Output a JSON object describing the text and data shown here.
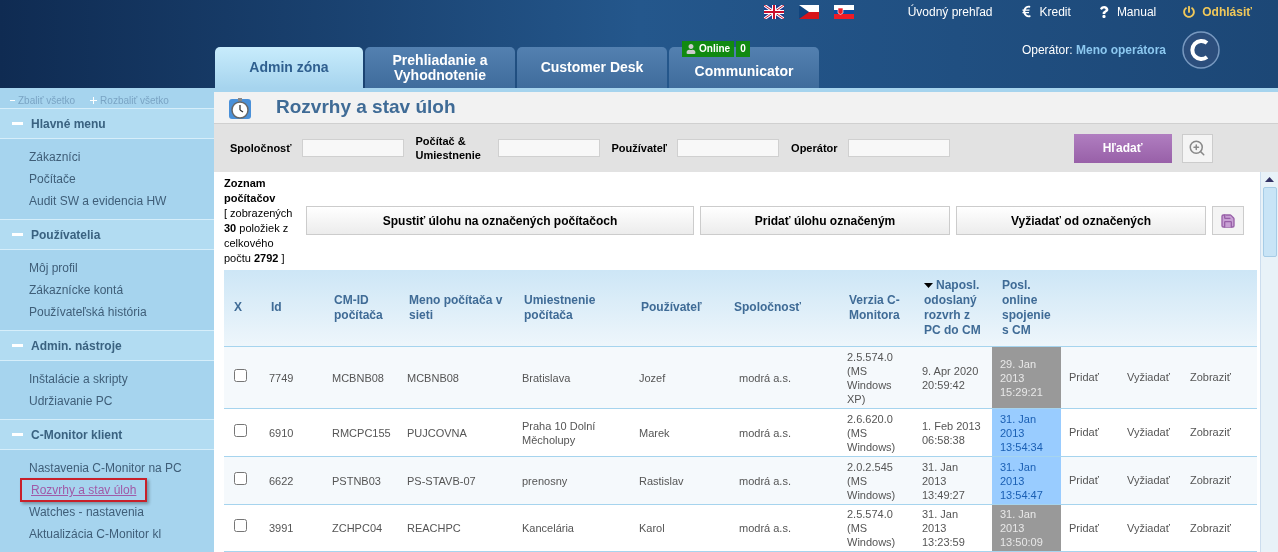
{
  "top_links": [
    {
      "label": "Úvodný prehľad",
      "kind": "plain"
    },
    {
      "label": "Kredit",
      "kind": "euro"
    },
    {
      "label": "Manual",
      "kind": "help"
    },
    {
      "label": "Odhlásiť",
      "kind": "logout"
    }
  ],
  "tabs": [
    {
      "label": "Admin zóna",
      "selected": true
    },
    {
      "label": "Prehliadanie a Vyhodnotenie",
      "selected": false
    },
    {
      "label": "Customer Desk",
      "selected": false
    },
    {
      "label": "Communicator",
      "selected": false,
      "badge": {
        "label": "Online",
        "count": "0"
      }
    }
  ],
  "operator": {
    "label": "Operátor:",
    "name": "Meno operátora"
  },
  "sidebar": {
    "collapse_all": "Zbaliť všetko",
    "expand_all": "Rozbaliť všetko",
    "sections": [
      {
        "title": "Hlavné menu",
        "expanded": true,
        "items": [
          {
            "label": "Zákazníci",
            "selected": false
          },
          {
            "label": "Počítače",
            "selected": false
          },
          {
            "label": "Audit SW a evidencia HW",
            "selected": false
          }
        ]
      },
      {
        "title": "Používatelia",
        "expanded": true,
        "items": [
          {
            "label": "Môj profil",
            "selected": false
          },
          {
            "label": "Zákaznícke kontá",
            "selected": false
          },
          {
            "label": "Používateľská história",
            "selected": false
          }
        ]
      },
      {
        "title": "Admin. nástroje",
        "expanded": true,
        "items": [
          {
            "label": "Inštalácie a skripty",
            "selected": false
          },
          {
            "label": "Udržiavanie PC",
            "selected": false
          }
        ]
      },
      {
        "title": "C-Monitor klient",
        "expanded": true,
        "items": [
          {
            "label": "Nastavenia C-Monitor na PC",
            "selected": false
          },
          {
            "label": "Rozvrhy a stav úloh",
            "selected": true
          },
          {
            "label": "Watches - nastavenia",
            "selected": false
          },
          {
            "label": "Aktualizácia C-Monitor kl",
            "selected": false
          }
        ]
      }
    ]
  },
  "page_title": "Rozvrhy a stav úloh",
  "filters": [
    {
      "label": "Spoločnosť"
    },
    {
      "label": "Počítač & Umiestnenie"
    },
    {
      "label": "Používateľ"
    },
    {
      "label": "Operátor"
    }
  ],
  "search_button": "Hľadať",
  "list_info": "**Zoznam počítačov**\n[ zobrazených **30** položiek z celkového počtu **2792** ]",
  "actions": [
    "Spustiť úlohu na označených počítačoch",
    "Pridať úlohu označeným",
    "Vyžiadať od označených"
  ],
  "table": {
    "columns": [
      {
        "label": "X",
        "sorted": false
      },
      {
        "label": "Id",
        "sorted": false
      },
      {
        "label": "CM-ID počítača",
        "sorted": false
      },
      {
        "label": "Meno počítača v sieti",
        "sorted": false
      },
      {
        "label": "Umiestnenie počítača",
        "sorted": false
      },
      {
        "label": "Používateľ",
        "sorted": false
      },
      {
        "label": "Spoločnosť",
        "sorted": false
      },
      {
        "label": "Verzia C-Monitora",
        "sorted": false
      },
      {
        "label": "Naposl. odoslaný rozvrh z PC do CM",
        "sorted": true
      },
      {
        "label": "Posl. online spojenie s CM",
        "sorted": false
      }
    ],
    "rows": [
      {
        "checked": false,
        "id": "7749",
        "cm_id": "MCBNB08",
        "name": "MCBNB08",
        "location": "Bratislava",
        "user": "Jozef",
        "company": "modrá a.s.",
        "version": "2.5.574.0 (MS Windows XP)",
        "last_schedule": "9. Apr 2020 20:59:42",
        "last_online": "29. Jan 2013 15:29:21",
        "color": "#999999",
        "links": [
          "Pridať",
          "Vyžiadať",
          "Zobraziť"
        ]
      },
      {
        "checked": false,
        "id": "6910",
        "cm_id": "RMCPC155",
        "name": "PUJCOVNA",
        "location": "Praha 10 Dolní Měcholupy",
        "user": "Marek",
        "company": "modrá a.s.",
        "version": "2.6.620.0 (MS Windows)",
        "last_schedule": "1. Feb 2013 06:58:38",
        "last_online": "31. Jan 2013 13:54:34",
        "color": "#99ccff",
        "links": [
          "Pridať",
          "Vyžiadať",
          "Zobraziť"
        ]
      },
      {
        "checked": false,
        "id": "6622",
        "cm_id": "PSTNB03",
        "name": "PS-STAVB-07",
        "location": "prenosny",
        "user": "Rastislav",
        "company": "modrá a.s.",
        "version": "2.0.2.545 (MS Windows)",
        "last_schedule": "31. Jan 2013 13:49:27",
        "last_online": "31. Jan 2013 13:54:47",
        "color": "#99ccff",
        "links": [
          "Pridať",
          "Vyžiadať",
          "Zobraziť"
        ]
      },
      {
        "checked": false,
        "id": "3991",
        "cm_id": "ZCHPC04",
        "name": "REACHPC",
        "location": "Kancelária",
        "user": "Karol",
        "company": "modrá a.s.",
        "version": "2.5.574.0 (MS Windows)",
        "last_schedule": "31. Jan 2013 13:23:59",
        "last_online": "31. Jan 2013 13:50:09",
        "color": "#999999",
        "links": [
          "Pridať",
          "Vyžiadať",
          "Zobraziť"
        ]
      }
    ]
  }
}
